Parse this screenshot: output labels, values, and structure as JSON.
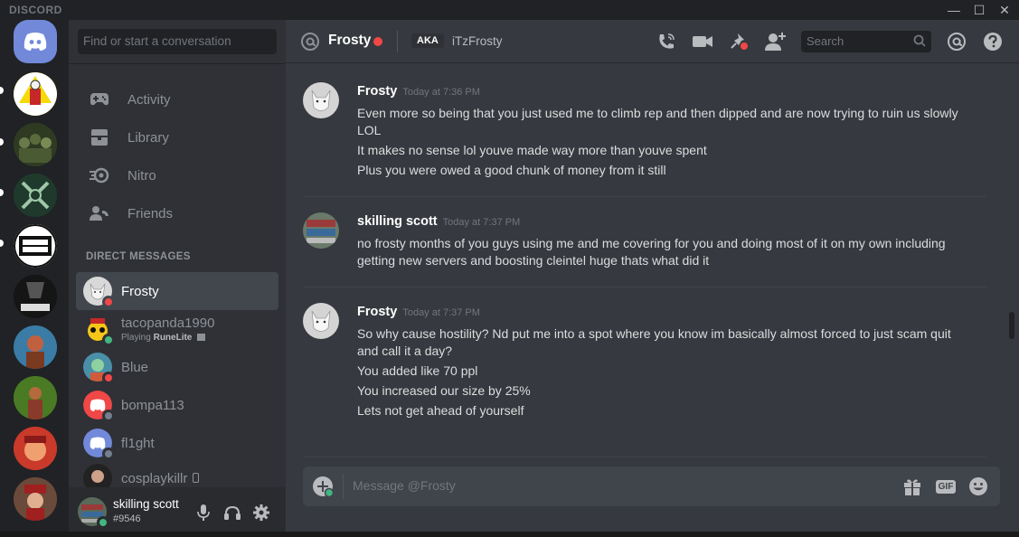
{
  "window": {
    "brand": "DISCORD",
    "min_label": "—",
    "max_label": "☐",
    "close_label": "✕"
  },
  "dm_search": {
    "placeholder": "Find or start a conversation"
  },
  "nav": [
    {
      "label": "Activity",
      "icon": "gamepad-icon"
    },
    {
      "label": "Library",
      "icon": "library-icon"
    },
    {
      "label": "Nitro",
      "icon": "nitro-icon"
    },
    {
      "label": "Friends",
      "icon": "friends-icon"
    }
  ],
  "dm_header": "DIRECT MESSAGES",
  "dms": [
    {
      "name": "Frosty",
      "status": "dnd",
      "status_color": "#f04747",
      "active": true
    },
    {
      "name": "tacopanda1990",
      "activity_prefix": "Playing",
      "activity_game": "RuneLite",
      "status": "online",
      "status_color": "#43b581"
    },
    {
      "name": "Blue",
      "status": "dnd",
      "status_color": "#f04747"
    },
    {
      "name": "bompa113",
      "status": "offline",
      "status_color": "#747f8d"
    },
    {
      "name": "fl1ght",
      "status": "offline",
      "status_color": "#747f8d"
    },
    {
      "name": "cosplaykillr",
      "status": "mobile",
      "status_color": "#43b581"
    }
  ],
  "user": {
    "name": "skilling scott",
    "tag": "#9546",
    "status_color": "#43b581"
  },
  "channel": {
    "name": "Frosty",
    "aka_label": "AKA",
    "aka_name": "iTzFrosty",
    "search_placeholder": "Search"
  },
  "messages": [
    {
      "author": "Frosty",
      "time": "Today at 7:36 PM",
      "lines": [
        "Even more so being that you just used me to climb rep and then dipped and are now trying to ruin us slowly LOL",
        "It makes no sense lol youve made way more than youve spent",
        "Plus you were owed a good chunk of money from it still"
      ]
    },
    {
      "author": "skilling scott",
      "time": "Today at 7:37 PM",
      "lines": [
        "no frosty months of you guys using me and me covering for you and doing most of it on my own including getting new servers and boosting cleintel huge thats what did it"
      ]
    },
    {
      "author": "Frosty",
      "time": "Today at 7:37 PM",
      "lines": [
        "So why cause hostility? Nd put me into a spot where you know im basically almost forced to just scam quit and call it a day?",
        "You added like 70 ppl",
        "You increased our size by 25%",
        "Lets not get ahead of yourself"
      ]
    }
  ],
  "composer": {
    "placeholder": "Message @Frosty",
    "gif_label": "GIF"
  },
  "colors": {
    "accent": "#7289da",
    "dnd": "#f04747",
    "online": "#43b581",
    "offline": "#747f8d"
  }
}
